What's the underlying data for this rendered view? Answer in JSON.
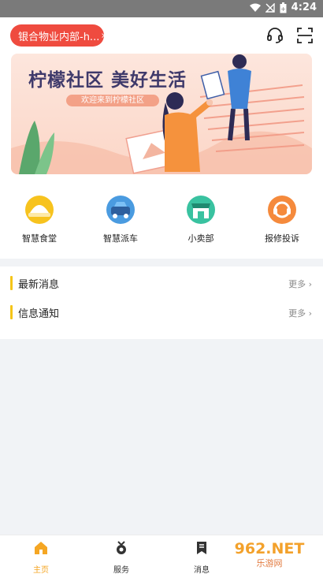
{
  "status_bar": {
    "time": "4:24"
  },
  "header": {
    "community_label": "银合物业内部-h...",
    "icons": [
      "headset-icon",
      "scan-icon"
    ]
  },
  "banner": {
    "title": "柠檬社区 美好生活",
    "subtitle": "欢迎来到柠檬社区"
  },
  "quick_actions": [
    {
      "label": "智慧食堂",
      "icon": "canteen-icon",
      "color": "#f7c31e"
    },
    {
      "label": "智慧派车",
      "icon": "car-icon",
      "color": "#4a9be0"
    },
    {
      "label": "小卖部",
      "icon": "shop-icon",
      "color": "#39c2a0"
    },
    {
      "label": "报修投诉",
      "icon": "repair-icon",
      "color": "#f58a3c"
    }
  ],
  "news_sections": [
    {
      "title": "最新消息",
      "more": "更多"
    },
    {
      "title": "信息通知",
      "more": "更多"
    }
  ],
  "bottom_nav": {
    "tabs": [
      {
        "label": "主页",
        "icon": "home-icon",
        "active": true
      },
      {
        "label": "服务",
        "icon": "service-icon",
        "active": false
      },
      {
        "label": "消息",
        "icon": "message-icon",
        "active": false
      }
    ],
    "active_color": "#f5a623"
  },
  "watermark": {
    "text": "962.NET",
    "sub": "乐游网"
  }
}
